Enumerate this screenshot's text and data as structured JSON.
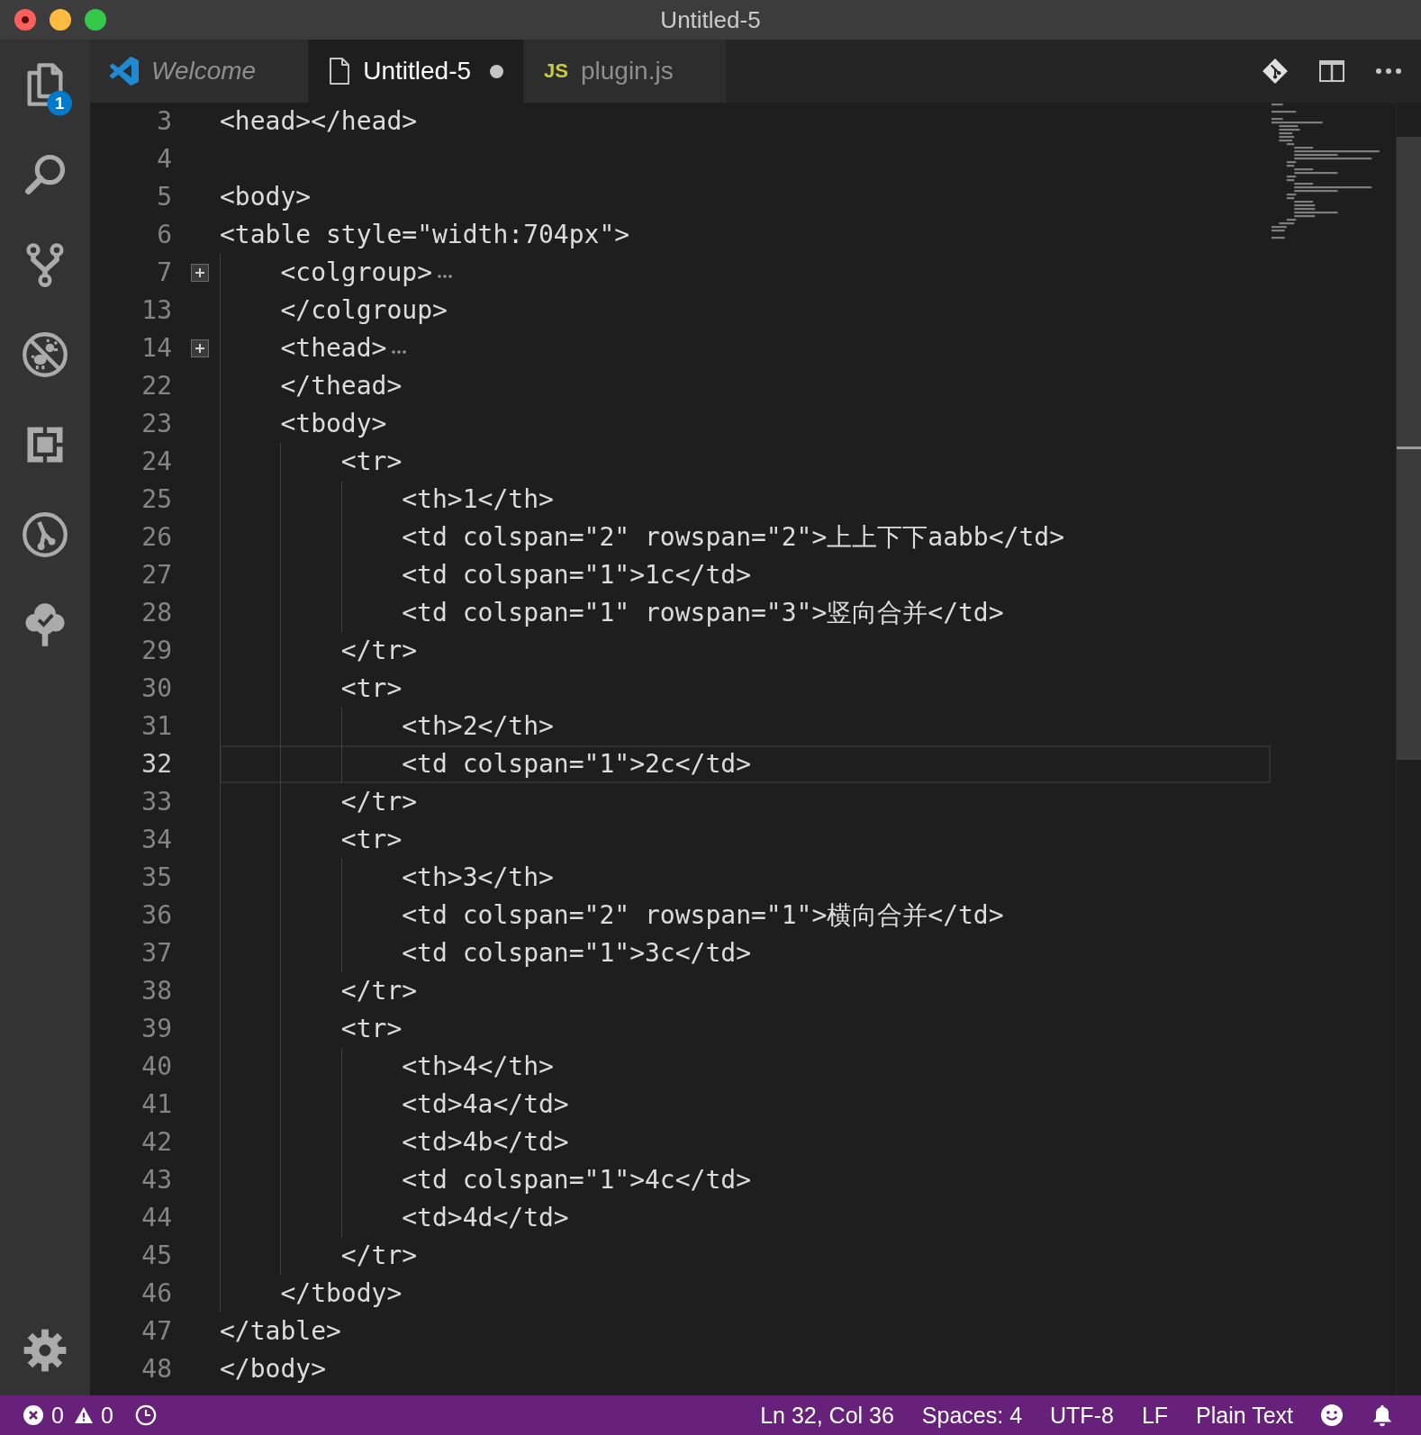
{
  "window": {
    "title": "Untitled-5"
  },
  "activity_bar": {
    "items": [
      {
        "kind": "explorer",
        "badge": "1"
      },
      {
        "kind": "search"
      },
      {
        "kind": "scm"
      },
      {
        "kind": "debug"
      },
      {
        "kind": "extensions"
      },
      {
        "kind": "git-graph"
      },
      {
        "kind": "tree"
      }
    ],
    "manage": {
      "kind": "settings"
    }
  },
  "tabs": [
    {
      "kind": "welcome",
      "label": "Welcome",
      "selected": false,
      "preview": true,
      "dirty": false
    },
    {
      "kind": "file",
      "label": "Untitled-5",
      "selected": true,
      "preview": false,
      "dirty": true
    },
    {
      "kind": "script",
      "icon_text": "JS",
      "label": "plugin.js",
      "selected": false,
      "preview": false,
      "dirty": false
    }
  ],
  "editor_actions": [
    {
      "kind": "open-changes"
    },
    {
      "kind": "split"
    },
    {
      "kind": "more"
    }
  ],
  "editor": {
    "lines": [
      {
        "number": "3",
        "text": "<head></head>",
        "current": false,
        "folded": false
      },
      {
        "number": "4",
        "current": false,
        "folded": false
      },
      {
        "number": "5",
        "text": "<body>",
        "current": false,
        "folded": false
      },
      {
        "number": "6",
        "text": "<table style=\"width:704px\">",
        "current": false,
        "folded": false,
        "children": [
          {
            "number": "7",
            "text": "<colgroup>",
            "current": false,
            "folded": true
          },
          {
            "number": "13",
            "text": "</colgroup>",
            "current": false,
            "folded": false
          },
          {
            "number": "14",
            "text": "<thead>",
            "current": false,
            "folded": true
          },
          {
            "number": "22",
            "text": "</thead>",
            "current": false,
            "folded": false
          },
          {
            "number": "23",
            "text": "<tbody>",
            "current": false,
            "folded": false,
            "children": [
              {
                "number": "24",
                "text": "<tr>",
                "current": false,
                "folded": false,
                "children": [
                  {
                    "number": "25",
                    "text": "<th>1</th>",
                    "current": false,
                    "folded": false
                  },
                  {
                    "number": "26",
                    "text": "<td colspan=\"2\" rowspan=\"2\">上上下下aabb</td>",
                    "current": false,
                    "folded": false
                  },
                  {
                    "number": "27",
                    "text": "<td colspan=\"1\">1c</td>",
                    "current": false,
                    "folded": false
                  },
                  {
                    "number": "28",
                    "text": "<td colspan=\"1\" rowspan=\"3\">竖向合并</td>",
                    "current": false,
                    "folded": false
                  }
                ]
              },
              {
                "number": "29",
                "text": "</tr>",
                "current": false,
                "folded": false
              },
              {
                "number": "30",
                "text": "<tr>",
                "current": false,
                "folded": false,
                "children": [
                  {
                    "number": "31",
                    "text": "<th>2</th>",
                    "current": false,
                    "folded": false
                  },
                  {
                    "number": "32",
                    "text": "<td colspan=\"1\">2c</td>",
                    "current": true,
                    "folded": false
                  }
                ]
              },
              {
                "number": "33",
                "text": "</tr>",
                "current": false,
                "folded": false
              },
              {
                "number": "34",
                "text": "<tr>",
                "current": false,
                "folded": false,
                "children": [
                  {
                    "number": "35",
                    "text": "<th>3</th>",
                    "current": false,
                    "folded": false
                  },
                  {
                    "number": "36",
                    "text": "<td colspan=\"2\" rowspan=\"1\">横向合并</td>",
                    "current": false,
                    "folded": false
                  },
                  {
                    "number": "37",
                    "text": "<td colspan=\"1\">3c</td>",
                    "current": false,
                    "folded": false
                  }
                ]
              },
              {
                "number": "38",
                "text": "</tr>",
                "current": false,
                "folded": false
              },
              {
                "number": "39",
                "text": "<tr>",
                "current": false,
                "folded": false,
                "children": [
                  {
                    "number": "40",
                    "text": "<th>4</th>",
                    "current": false,
                    "folded": false
                  },
                  {
                    "number": "41",
                    "text": "<td>4a</td>",
                    "current": false,
                    "folded": false
                  },
                  {
                    "number": "42",
                    "text": "<td>4b</td>",
                    "current": false,
                    "folded": false
                  },
                  {
                    "number": "43",
                    "text": "<td colspan=\"1\">4c</td>",
                    "current": false,
                    "folded": false
                  },
                  {
                    "number": "44",
                    "text": "<td>4d</td>",
                    "current": false,
                    "folded": false
                  }
                ]
              },
              {
                "number": "45",
                "text": "</tr>",
                "current": false,
                "folded": false
              }
            ]
          },
          {
            "number": "46",
            "text": "</tbody>",
            "current": false,
            "folded": false
          }
        ]
      },
      {
        "number": "47",
        "text": "</table>",
        "current": false,
        "folded": false
      },
      {
        "number": "48",
        "text": "</body>",
        "current": false,
        "folded": false
      }
    ]
  },
  "status_bar": {
    "errors": "0",
    "warnings": "0",
    "items": [
      "Ln 32, Col 36",
      "Spaces: 4",
      "UTF-8",
      "LF",
      "Plain Text"
    ]
  }
}
